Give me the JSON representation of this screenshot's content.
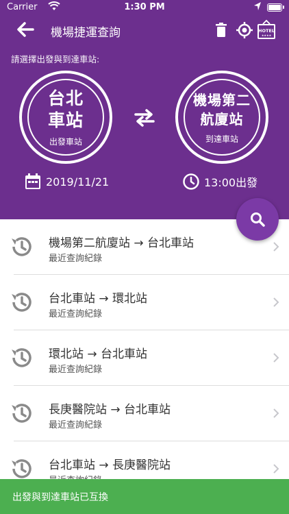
{
  "status_bar": {
    "carrier": "Carrier",
    "time": "1:30 PM"
  },
  "nav": {
    "title": "機場捷運查詢"
  },
  "prompt": "請選擇出發與到達車站:",
  "departure": {
    "name_line1": "台北",
    "name_line2": "車站",
    "role": "出發車站"
  },
  "arrival": {
    "name_line1": "機場第二",
    "name_line2": "航廈站",
    "role": "到達車站"
  },
  "date": "2019/11/21",
  "time": "13:00出發",
  "icons": {
    "hotel_text": "HOTEL"
  },
  "history": [
    {
      "route": "機場第二航廈站 → 台北車站",
      "sub": "最近查詢紀錄"
    },
    {
      "route": "台北車站 → 環北站",
      "sub": "最近查詢紀錄"
    },
    {
      "route": "環北站 → 台北車站",
      "sub": "最近查詢紀錄"
    },
    {
      "route": "長庚醫院站 → 台北車站",
      "sub": "最近查詢紀錄"
    },
    {
      "route": "台北車站 → 長庚醫院站",
      "sub": "最近查詢紀錄"
    }
  ],
  "toast": "出發與到達車站已互換",
  "colors": {
    "header": "#6c2f8e",
    "fab": "#7b3aa6",
    "toast": "#4caf50"
  }
}
